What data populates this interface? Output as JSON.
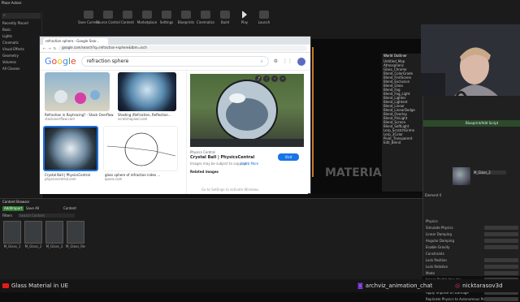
{
  "editor": {
    "place_actors": "Place Actors",
    "left_items": [
      "Recently Placed",
      "Basic",
      "Lights",
      "Cinematic",
      "Visual Effects",
      "Geometry",
      "Volumes",
      "All Classes"
    ],
    "toolbar": [
      "Save Current",
      "Source Control",
      "Content",
      "Marketplace",
      "Settings",
      "Blueprints",
      "Cinematics",
      "Build",
      "Play",
      "Launch"
    ],
    "material_label": "MATERIAL",
    "world_outliner": "World Outliner",
    "outliner_items": [
      "Untitled_Map",
      "Atmospheric",
      "Glass_Chrome",
      "Blend_ColorGrade",
      "Blend_FirstScene",
      "Blend_Exclusion",
      "Blend_Glass",
      "Blend_Fog",
      "Blend_Fog_Light",
      "Blend_Lighter",
      "Blend_Lightest",
      "Blend_Linear",
      "Blend_LinearDodge",
      "Blend_Overlay",
      "Blend_PinLight",
      "Blend_Screen",
      "Blend_SoftLight",
      "Lerp_ScratchGrime",
      "Lerp_3Color",
      "Pivot_Transparent",
      "Edit_Blend"
    ],
    "details_title": "Details",
    "details_rows": [
      "Physics",
      "Simulate Physics",
      "Linear Damping",
      "Angular Damping",
      "Enable Gravity",
      "Constraints",
      "Lock Position",
      "Lock Rotation",
      "Mode",
      "Ignore Radial Impulse",
      "Ignore Radial Force",
      "Apply Impulse on Damage",
      "Replicate Physics to Autonomous Proxy"
    ],
    "add_blueprint": "Blueprint/Add Script",
    "material_slot": "M_Glass_2",
    "element_label": "Element 0",
    "content_browser": "Content Browser",
    "add_import": "Add/Import",
    "save_all": "Save All",
    "content_path": "Content",
    "filters": "Filters",
    "search_placeholder": "Search Content",
    "assets": [
      "M_Glass_1",
      "M_Glass_2",
      "M_Glass_3",
      "M_Glass_Red"
    ]
  },
  "browser": {
    "tab_title": "refraction sphere - Google Sear...",
    "url": "google.com/search?q=refraction+sphere&tbm=isch",
    "google_logo": "Google",
    "query": "refraction sphere",
    "results": [
      {
        "caption": "Refraction in Raytracing? - Stack Overflow",
        "source": "stackoverflow.com"
      },
      {
        "caption": "Shading (Refraction, Reflection...",
        "source": "scratchapixel.com"
      },
      {
        "caption": "Crystal Ball | PhysicsCentral",
        "source": "physicscentral.com"
      },
      {
        "caption": "glass sphere of refraction index ...",
        "source": "quora.com"
      }
    ],
    "preview_site": "Physics Central",
    "preview_title": "Crystal Ball | PhysicsCentral",
    "preview_note": "Images may be subject to copyright.",
    "learn_more": "Learn More",
    "visit": "Visit",
    "related": "Related images",
    "watermark": "Go to Settings to activate Windows."
  },
  "stream": {
    "title": "Glass Material in UE",
    "chat": "archviz_animation_chat",
    "handle": "nicktarasov3d"
  },
  "colors": {
    "brand_blue": "#1a73e8",
    "ue_green": "#3bb14a",
    "twitch_red": "#e91916"
  }
}
